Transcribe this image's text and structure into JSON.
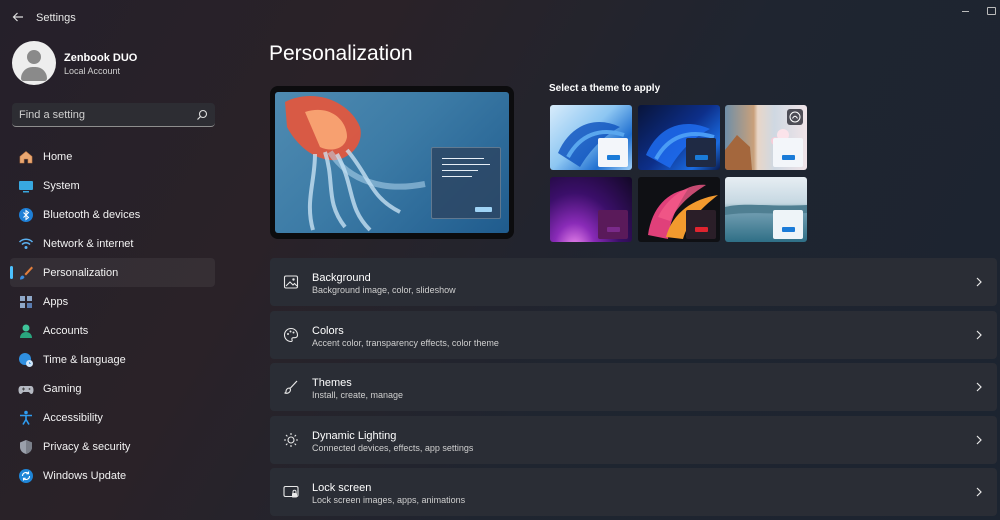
{
  "window": {
    "app_title": "Settings"
  },
  "profile": {
    "name": "Zenbook DUO",
    "account_type": "Local Account"
  },
  "search": {
    "placeholder": "Find a setting",
    "icon": "search-icon"
  },
  "sidebar": {
    "items": [
      {
        "label": "Home",
        "icon": "home-icon",
        "active": false
      },
      {
        "label": "System",
        "icon": "monitor-icon",
        "active": false
      },
      {
        "label": "Bluetooth & devices",
        "icon": "bluetooth-icon",
        "active": false
      },
      {
        "label": "Network & internet",
        "icon": "wifi-icon",
        "active": false
      },
      {
        "label": "Personalization",
        "icon": "paintbrush-icon",
        "active": true
      },
      {
        "label": "Apps",
        "icon": "apps-icon",
        "active": false
      },
      {
        "label": "Accounts",
        "icon": "person-icon",
        "active": false
      },
      {
        "label": "Time & language",
        "icon": "globe-clock-icon",
        "active": false
      },
      {
        "label": "Gaming",
        "icon": "gamepad-icon",
        "active": false
      },
      {
        "label": "Accessibility",
        "icon": "accessibility-icon",
        "active": false
      },
      {
        "label": "Privacy & security",
        "icon": "shield-icon",
        "active": false
      },
      {
        "label": "Windows Update",
        "icon": "update-icon",
        "active": false
      }
    ]
  },
  "main": {
    "title": "Personalization",
    "themes_title": "Select a theme to apply",
    "cards": [
      {
        "title": "Background",
        "subtitle": "Background image, color, slideshow",
        "icon": "image-icon"
      },
      {
        "title": "Colors",
        "subtitle": "Accent color, transparency effects, color theme",
        "icon": "palette-icon"
      },
      {
        "title": "Themes",
        "subtitle": "Install, create, manage",
        "icon": "brush-icon"
      },
      {
        "title": "Dynamic Lighting",
        "subtitle": "Connected devices, effects, app settings",
        "icon": "sun-icon"
      },
      {
        "title": "Lock screen",
        "subtitle": "Lock screen images, apps, animations",
        "icon": "lock-screen-icon"
      }
    ]
  },
  "colors": {
    "accent": "#4cc2ff",
    "card": "#2a2d35"
  }
}
